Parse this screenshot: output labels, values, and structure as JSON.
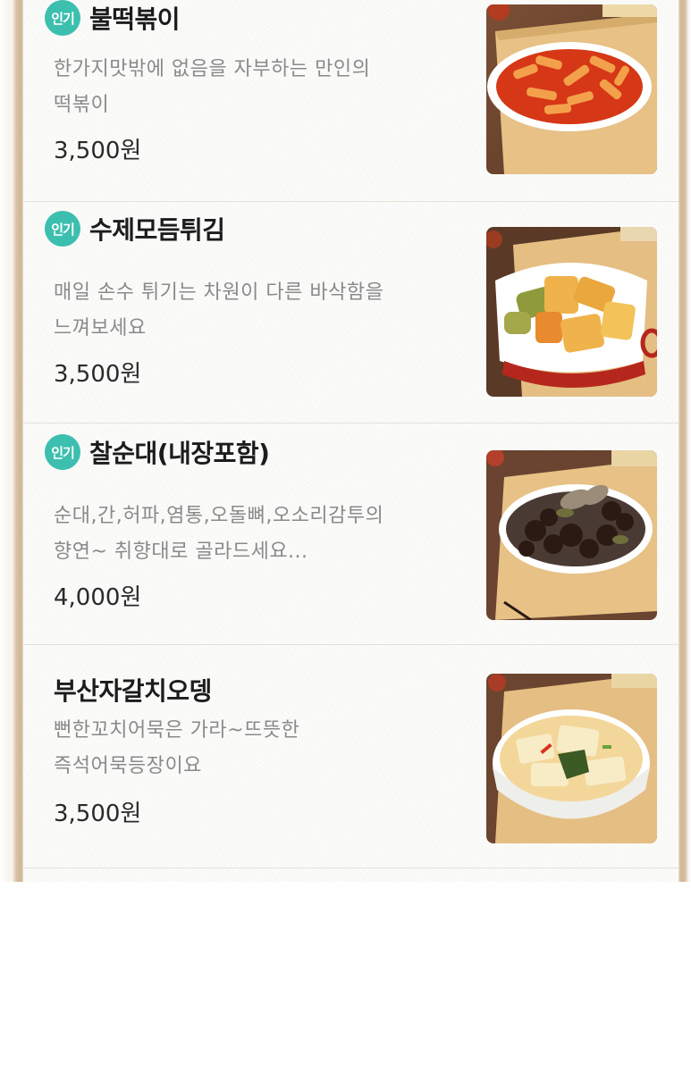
{
  "menu": {
    "items": [
      {
        "badge": "인기",
        "name": "불떡볶이",
        "desc_line1": "한가지맛밖에 없음을 자부하는 만인의",
        "desc_line2": "떡볶이",
        "price": "3,500원"
      },
      {
        "badge": "인기",
        "name": "수제모듬튀김",
        "desc_line1": "매일 손수 튀기는 차원이 다른 바삭함을",
        "desc_line2": "느껴보세요",
        "price": "3,500원"
      },
      {
        "badge": "인기",
        "name": "찰순대(내장포함)",
        "desc_line1": "순대,간,허파,염통,오돌뼈,오소리감투의",
        "desc_line2": "향연~ 취향대로 골라드세요...",
        "price": "4,000원"
      },
      {
        "badge": "",
        "name": "부산자갈치오뎅",
        "desc_line1": "뻔한꼬치어묵은 가라~뜨뜻한",
        "desc_line2": "즉석어묵등장이요",
        "price": "3,500원"
      }
    ]
  },
  "colors": {
    "badge_bg": "#3cbfae",
    "name_text": "#1c1c1c",
    "desc_text": "#8a8a8a",
    "frame_wood": "#cfb493"
  },
  "icons": {
    "badge": "popular-badge-icon"
  }
}
